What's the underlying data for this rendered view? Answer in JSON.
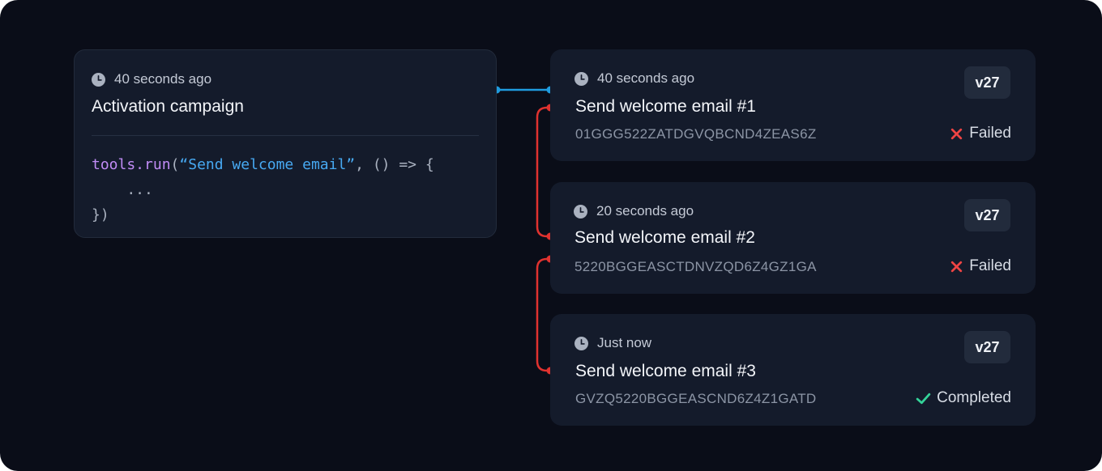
{
  "source": {
    "timestamp": "40 seconds ago",
    "title": "Activation campaign",
    "code": {
      "fn": "tools.run",
      "open_paren": "(",
      "str": "“Send welcome email”",
      "rest": ", () => {",
      "line2": "    ...",
      "line3": "})"
    }
  },
  "runs": [
    {
      "timestamp": "40 seconds ago",
      "title": "Send welcome email  #1",
      "id": "01GGG522ZATDGVQBCND4ZEAS6Z",
      "version": "v27",
      "status": "Failed"
    },
    {
      "timestamp": "20 seconds ago",
      "title": "Send welcome email  #2",
      "id": "5220BGGEASCTDNVZQD6Z4GZ1GA",
      "version": "v27",
      "status": "Failed"
    },
    {
      "timestamp": "Just now",
      "title": "Send welcome email  #3",
      "id": "GVZQ5220BGGEASCND6Z4Z1GATD",
      "version": "v27",
      "status": "Completed"
    }
  ],
  "colors": {
    "background": "#0a0d18",
    "card": "#141b2b",
    "connector_blue": "#1f9bde",
    "connector_red": "#e0322f",
    "failed": "#ef4444",
    "completed": "#34d399"
  },
  "icons": {
    "timestamp": "clock-icon",
    "failed": "x-icon",
    "completed": "check-icon"
  }
}
